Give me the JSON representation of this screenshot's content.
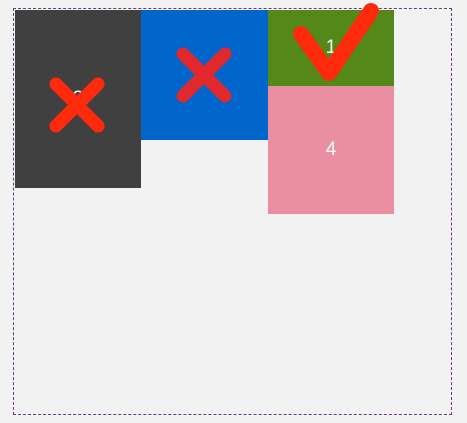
{
  "boxes": {
    "box1": {
      "label": "1",
      "color": "#548818",
      "state": "accepted",
      "mark_icon": "checkmark-icon",
      "mark_color": "#ff2a0c"
    },
    "box2": {
      "label": "2",
      "color": "#0066cc",
      "state": "rejected",
      "mark_icon": "cross-icon",
      "mark_color": "#e0282d"
    },
    "box3": {
      "label": "3",
      "color": "#404040",
      "state": "rejected",
      "mark_icon": "cross-icon",
      "mark_color": "#ff2a0c"
    },
    "box4": {
      "label": "4",
      "color": "#ea8fa1",
      "state": "none"
    }
  },
  "container": {
    "border_color": "#6e3b7a",
    "border_style": "dashed"
  }
}
